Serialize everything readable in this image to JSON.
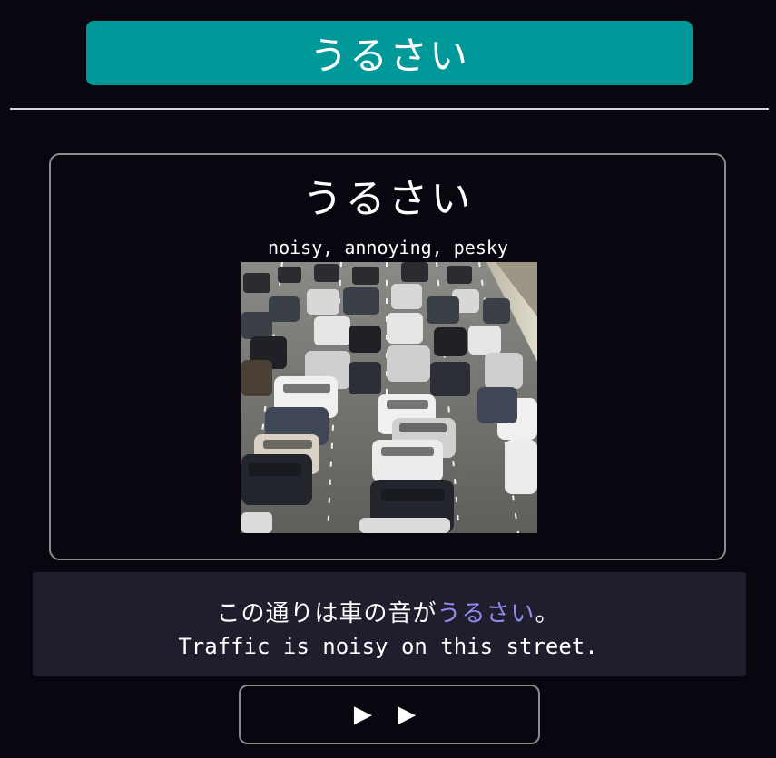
{
  "header": {
    "title": "うるさい"
  },
  "card": {
    "word": "うるさい",
    "meaning": "noisy, annoying, pesky",
    "image_icon": "traffic-jam-photo"
  },
  "example": {
    "japanese_before": "この通りは車の音が",
    "japanese_highlight": "うるさい",
    "japanese_after": "。",
    "english": "Traffic is noisy on this street."
  },
  "audio": {
    "play_label": "▶ ▶"
  },
  "colors": {
    "background": "#08060f",
    "header": "#009898",
    "highlight": "#8e8cf0",
    "sentence_box": "#201e2c",
    "border": "#8c8c8c"
  }
}
